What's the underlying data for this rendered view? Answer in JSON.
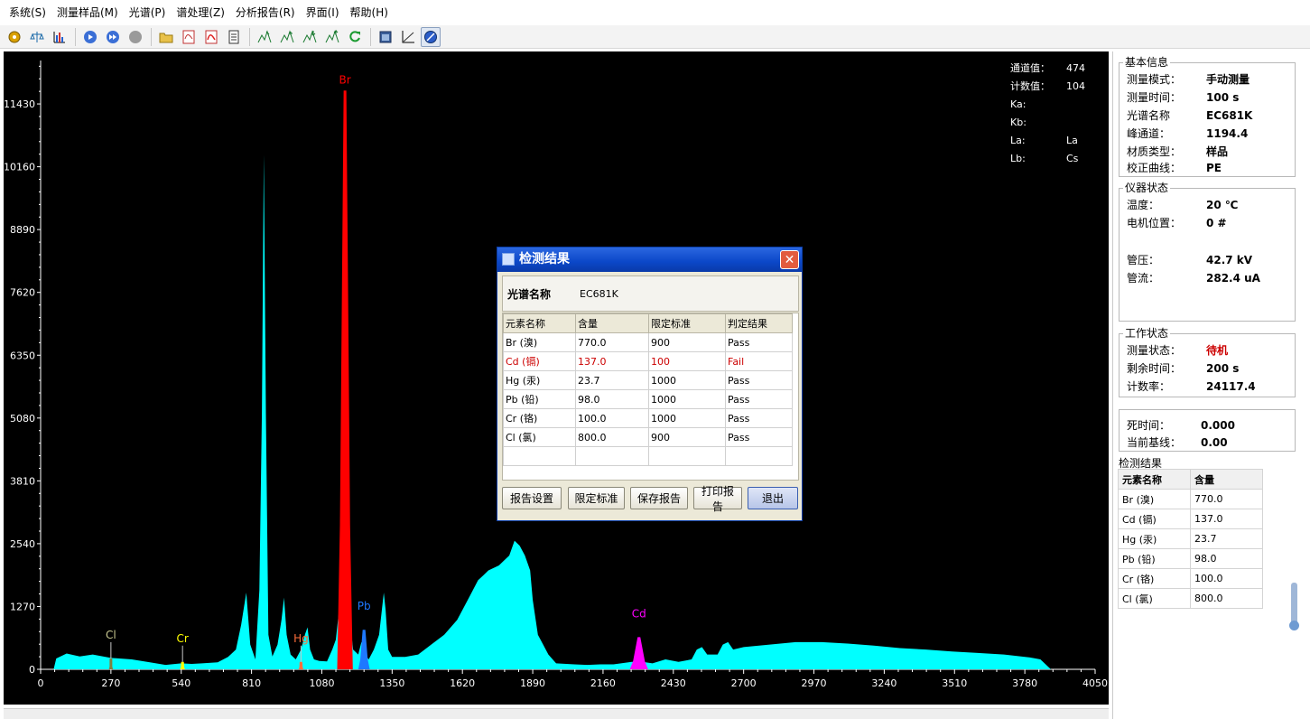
{
  "menu": [
    "系统(S)",
    "测量样品(M)",
    "光谱(P)",
    "谱处理(Z)",
    "分析报告(R)",
    "界面(I)",
    "帮助(H)"
  ],
  "toolbar": {
    "icons": [
      "tool-gear-icon",
      "tool-balance-icon",
      "tool-bar-chart-icon",
      "tool-play-icon",
      "tool-forward-icon",
      "tool-stop-icon",
      "tool-open-folder-icon",
      "tool-pdf-icon",
      "tool-pdf-red-icon",
      "tool-document-icon",
      "tool-peak-1-icon",
      "tool-peak-2-icon",
      "tool-peak-3-icon",
      "tool-peak-4-icon",
      "tool-refresh-icon",
      "tool-window-icon",
      "tool-axes-icon",
      "tool-compass-icon"
    ]
  },
  "chart_data": {
    "type": "area",
    "background": "#000000",
    "series_color": "#00ffff",
    "xlim": [
      0,
      4050
    ],
    "ylim": [
      0,
      12000
    ],
    "x_ticks": [
      "0",
      "270",
      "540",
      "810",
      "1080",
      "1350",
      "1620",
      "1890",
      "2160",
      "2430",
      "2700",
      "2970",
      "3240",
      "3510",
      "3780",
      "4050"
    ],
    "y_ticks": [
      "0",
      "1270",
      "2540",
      "3810",
      "5080",
      "6350",
      "7620",
      "8890",
      "10160",
      "11430"
    ],
    "points": [
      [
        50,
        0
      ],
      [
        60,
        220
      ],
      [
        100,
        320
      ],
      [
        150,
        260
      ],
      [
        200,
        300
      ],
      [
        270,
        230
      ],
      [
        350,
        200
      ],
      [
        420,
        140
      ],
      [
        480,
        90
      ],
      [
        540,
        120
      ],
      [
        580,
        110
      ],
      [
        620,
        120
      ],
      [
        680,
        140
      ],
      [
        720,
        250
      ],
      [
        750,
        400
      ],
      [
        770,
        900
      ],
      [
        790,
        1550
      ],
      [
        805,
        500
      ],
      [
        825,
        200
      ],
      [
        840,
        1600
      ],
      [
        850,
        5200
      ],
      [
        857,
        10400
      ],
      [
        865,
        5200
      ],
      [
        875,
        700
      ],
      [
        890,
        260
      ],
      [
        910,
        500
      ],
      [
        925,
        1000
      ],
      [
        935,
        1450
      ],
      [
        945,
        700
      ],
      [
        960,
        300
      ],
      [
        980,
        200
      ],
      [
        1000,
        400
      ],
      [
        1015,
        700
      ],
      [
        1025,
        850
      ],
      [
        1035,
        400
      ],
      [
        1050,
        200
      ],
      [
        1070,
        170
      ],
      [
        1100,
        160
      ],
      [
        1120,
        400
      ],
      [
        1134,
        600
      ],
      [
        1146,
        1200
      ],
      [
        1155,
        4500
      ],
      [
        1162,
        9000
      ],
      [
        1169,
        11700
      ],
      [
        1176,
        9000
      ],
      [
        1183,
        4500
      ],
      [
        1190,
        900
      ],
      [
        1200,
        400
      ],
      [
        1220,
        300
      ],
      [
        1232,
        550
      ],
      [
        1245,
        300
      ],
      [
        1260,
        200
      ],
      [
        1280,
        400
      ],
      [
        1300,
        700
      ],
      [
        1318,
        1550
      ],
      [
        1325,
        1200
      ],
      [
        1335,
        400
      ],
      [
        1350,
        250
      ],
      [
        1400,
        250
      ],
      [
        1450,
        300
      ],
      [
        1500,
        500
      ],
      [
        1550,
        700
      ],
      [
        1600,
        1000
      ],
      [
        1650,
        1500
      ],
      [
        1680,
        1800
      ],
      [
        1700,
        1900
      ],
      [
        1720,
        2000
      ],
      [
        1760,
        2100
      ],
      [
        1800,
        2300
      ],
      [
        1820,
        2600
      ],
      [
        1840,
        2500
      ],
      [
        1860,
        2300
      ],
      [
        1880,
        2000
      ],
      [
        1890,
        1400
      ],
      [
        1910,
        700
      ],
      [
        1930,
        500
      ],
      [
        1950,
        300
      ],
      [
        1980,
        120
      ],
      [
        2050,
        100
      ],
      [
        2100,
        90
      ],
      [
        2150,
        100
      ],
      [
        2200,
        100
      ],
      [
        2270,
        150
      ],
      [
        2300,
        160
      ],
      [
        2350,
        120
      ],
      [
        2400,
        200
      ],
      [
        2450,
        150
      ],
      [
        2500,
        200
      ],
      [
        2520,
        400
      ],
      [
        2540,
        450
      ],
      [
        2560,
        300
      ],
      [
        2600,
        300
      ],
      [
        2620,
        500
      ],
      [
        2640,
        550
      ],
      [
        2660,
        400
      ],
      [
        2700,
        450
      ],
      [
        2800,
        500
      ],
      [
        2900,
        550
      ],
      [
        3000,
        550
      ],
      [
        3100,
        520
      ],
      [
        3200,
        480
      ],
      [
        3300,
        430
      ],
      [
        3400,
        400
      ],
      [
        3500,
        360
      ],
      [
        3600,
        330
      ],
      [
        3700,
        300
      ],
      [
        3800,
        240
      ],
      [
        3840,
        200
      ],
      [
        3860,
        100
      ],
      [
        3880,
        0
      ]
    ],
    "peaks": [
      {
        "label": "Br",
        "x": 1169,
        "height": 11700,
        "color": "#ff0000",
        "halfwidth": 30
      },
      {
        "label": "Pb",
        "x": 1242,
        "height": 800,
        "color": "#1e78ff",
        "halfwidth": 22
      },
      {
        "label": "Cd",
        "x": 2298,
        "height": 650,
        "color": "#ff00ff",
        "halfwidth": 35
      },
      {
        "label": "Hg",
        "x": 1000,
        "height": 150,
        "color": "#ff6f3c",
        "halfwidth": 10
      },
      {
        "label": "Cr",
        "x": 545,
        "height": 150,
        "color": "#ffff00",
        "halfwidth": 10
      },
      {
        "label": "Cl",
        "x": 270,
        "height": 220,
        "color": "#808040",
        "halfwidth": 8
      }
    ]
  },
  "readout": {
    "channel_label": "通道值：",
    "channel_value": "474",
    "count_label": "计数值：",
    "count_value": "104",
    "ka_label": "Ka:",
    "ka_value": "",
    "kb_label": "Kb:",
    "kb_value": "",
    "la_label": "La:",
    "la_value": "La",
    "lb_label": "Lb:",
    "lb_value": "Cs"
  },
  "basic_info": {
    "title": "基本信息",
    "rows": [
      {
        "k": "测量模式：",
        "v": "手动测量"
      },
      {
        "k": "测量时间：",
        "v": "100 s"
      },
      {
        "k": "光谱名称",
        "v": "EC681K"
      },
      {
        "k": "峰通道：",
        "v": "1194.4"
      },
      {
        "k": "材质类型：",
        "v": "样品"
      },
      {
        "k": "校正曲线：",
        "v": "PE"
      }
    ]
  },
  "instrument": {
    "title": "仪器状态",
    "rows": [
      {
        "k": "温度：",
        "v": "20 ℃"
      },
      {
        "k": "电机位置：",
        "v": "0 #"
      },
      {
        "k": "管压：",
        "v": "42.7 kV"
      },
      {
        "k": "管流：",
        "v": "282.4 uA"
      }
    ]
  },
  "work": {
    "title": "工作状态",
    "rows": [
      {
        "k": "测量状态：",
        "v": "待机",
        "red": true
      },
      {
        "k": "剩余时间：",
        "v": "200 s"
      },
      {
        "k": "计数率：",
        "v": "24117.4"
      }
    ]
  },
  "dead": {
    "rows": [
      {
        "k": "死时间：",
        "v": "0.000"
      },
      {
        "k": "当前基线：",
        "v": "0.00"
      }
    ]
  },
  "detect": {
    "title": "检测结果",
    "headers": [
      "元素名称",
      "含量"
    ],
    "rows": [
      [
        "Br (溴)",
        "770.0"
      ],
      [
        "Cd (镉)",
        "137.0"
      ],
      [
        "Hg (汞)",
        "23.7"
      ],
      [
        "Pb (铅)",
        "98.0"
      ],
      [
        "Cr (铬)",
        "100.0"
      ],
      [
        "Cl (氯)",
        "800.0"
      ]
    ]
  },
  "dialog": {
    "title": "检测结果",
    "name_label": "光谱名称",
    "name_value": "EC681K",
    "headers": [
      "元素名称",
      "含量",
      "限定标准",
      "判定结果"
    ],
    "rows": [
      {
        "cells": [
          "Br (溴)",
          "770.0",
          "900",
          "Pass"
        ],
        "fail": false
      },
      {
        "cells": [
          "Cd (镉)",
          "137.0",
          "100",
          "Fail"
        ],
        "fail": true
      },
      {
        "cells": [
          "Hg (汞)",
          "23.7",
          "1000",
          "Pass"
        ],
        "fail": false
      },
      {
        "cells": [
          "Pb (铅)",
          "98.0",
          "1000",
          "Pass"
        ],
        "fail": false
      },
      {
        "cells": [
          "Cr (铬)",
          "100.0",
          "1000",
          "Pass"
        ],
        "fail": false
      },
      {
        "cells": [
          "Cl (氯)",
          "800.0",
          "900",
          "Pass"
        ],
        "fail": false
      }
    ],
    "buttons": [
      "报告设置",
      "限定标准",
      "保存报告",
      "打印报告",
      "退出"
    ]
  }
}
